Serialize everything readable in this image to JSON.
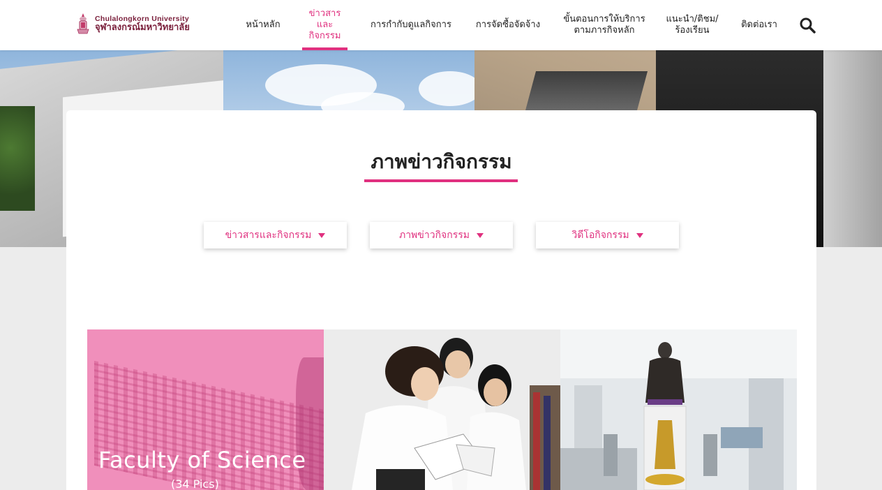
{
  "header": {
    "logo": {
      "name_en": "Chulalongkorn University",
      "name_th": "จุฬาลงกรณ์มหาวิทยาลัย",
      "seal_icon": "university-seal-icon"
    },
    "nav": [
      {
        "label": "หน้าหลัก",
        "active": false
      },
      {
        "label": "ข่าวสารและ\nกิจกรรม",
        "active": true
      },
      {
        "label": "การกำกับดูแลกิจการ",
        "active": false
      },
      {
        "label": "การจัดซื้อจัดจ้าง",
        "active": false
      },
      {
        "label": "ขั้นตอนการให้บริการ\nตามภารกิจหลัก",
        "active": false
      },
      {
        "label": "แนะนำ/ติชม/\nร้องเรียน",
        "active": false
      },
      {
        "label": "ติดต่อเรา",
        "active": false
      }
    ],
    "search_icon": "search-icon"
  },
  "page": {
    "title": "ภาพข่าวกิจกรรม",
    "filters": [
      {
        "label": "ข่าวสารและกิจกรรม",
        "icon": "caret-down-icon"
      },
      {
        "label": "ภาพข่าวกิจกรรม",
        "icon": "caret-down-icon"
      },
      {
        "label": "วิดีโอกิจกรรม",
        "icon": "caret-down-icon"
      }
    ]
  },
  "gallery": [
    {
      "title": "Faculty of Science",
      "subtitle": "(34 Pics)"
    },
    {
      "title": "",
      "subtitle": ""
    },
    {
      "title": "",
      "subtitle": ""
    }
  ],
  "colors": {
    "accent": "#e0307f",
    "tile_overlay": "#f08fbb",
    "logo": "#7a1f3b"
  }
}
